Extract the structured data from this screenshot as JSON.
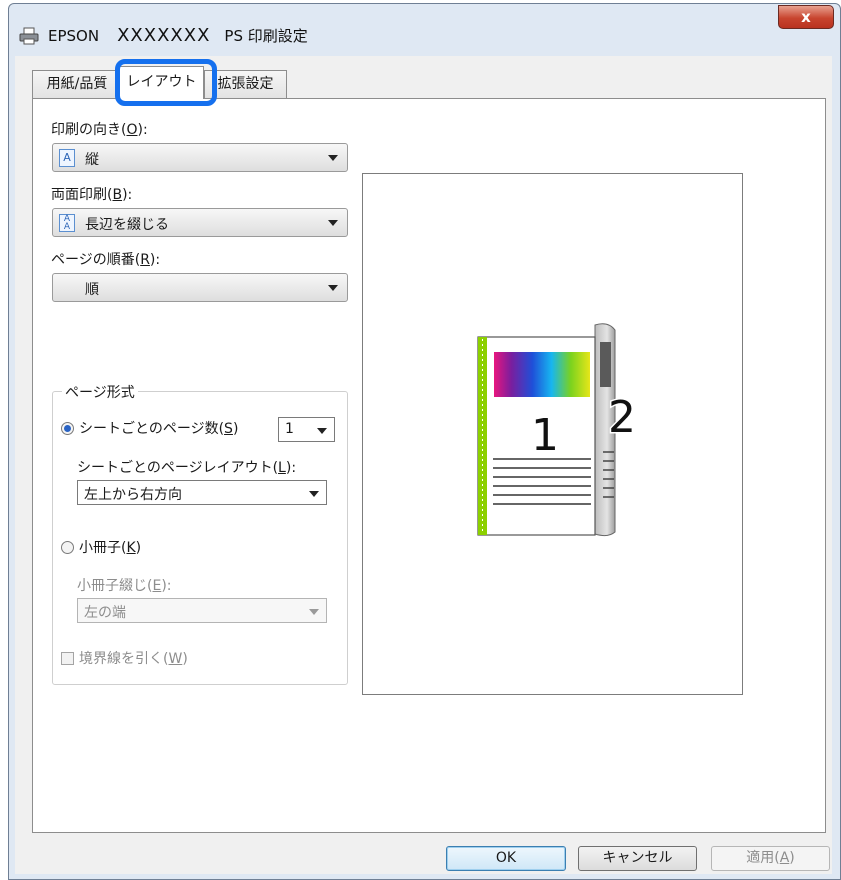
{
  "window": {
    "brand": "EPSON",
    "model": "XXXXXXX",
    "title": "PS 印刷設定",
    "close_label": "x"
  },
  "tabs": [
    {
      "label": "用紙/品質",
      "active": false
    },
    {
      "label": "レイアウト",
      "active": true
    },
    {
      "label": "拡張設定",
      "active": false
    }
  ],
  "layout": {
    "orientation": {
      "label": "印刷の向き(",
      "hotkey": "O",
      "label_end": "):",
      "value": "縦",
      "icon": "portrait-icon"
    },
    "duplex": {
      "label": "両面印刷(",
      "hotkey": "B",
      "label_end": "):",
      "value": "長辺を綴じる",
      "icon": "long-edge-binding-icon"
    },
    "page_order": {
      "label": "ページの順番(",
      "hotkey": "R",
      "label_end": "):",
      "value": "順"
    },
    "page_format": {
      "title": "ページ形式",
      "pages_per_sheet": {
        "label": "シートごとのページ数(",
        "hotkey": "S",
        "label_end": ")",
        "value": "1",
        "selected": true
      },
      "pages_per_sheet_layout": {
        "label": "シートごとのページレイアウト(",
        "hotkey": "L",
        "label_end": "):",
        "value": "左上から右方向"
      },
      "booklet": {
        "label": "小冊子(",
        "hotkey": "K",
        "label_end": ")",
        "selected": false
      },
      "booklet_binding": {
        "label": "小冊子綴じ(",
        "hotkey": "E",
        "label_end": "):",
        "value": "左の端",
        "enabled": false
      },
      "draw_borders": {
        "label": "境界線を引く(",
        "hotkey": "W",
        "label_end": ")",
        "checked": false,
        "enabled": false
      }
    }
  },
  "preview": {
    "front_page_number": "1",
    "back_page_number": "2"
  },
  "buttons": {
    "ok": "OK",
    "cancel": "キャンセル",
    "apply": "適用(",
    "apply_hotkey": "A",
    "apply_end": ")"
  },
  "colors": {
    "highlight": "#1570EE",
    "binding_edge": "#8CD000",
    "selected_radio": "#2A63C4"
  }
}
